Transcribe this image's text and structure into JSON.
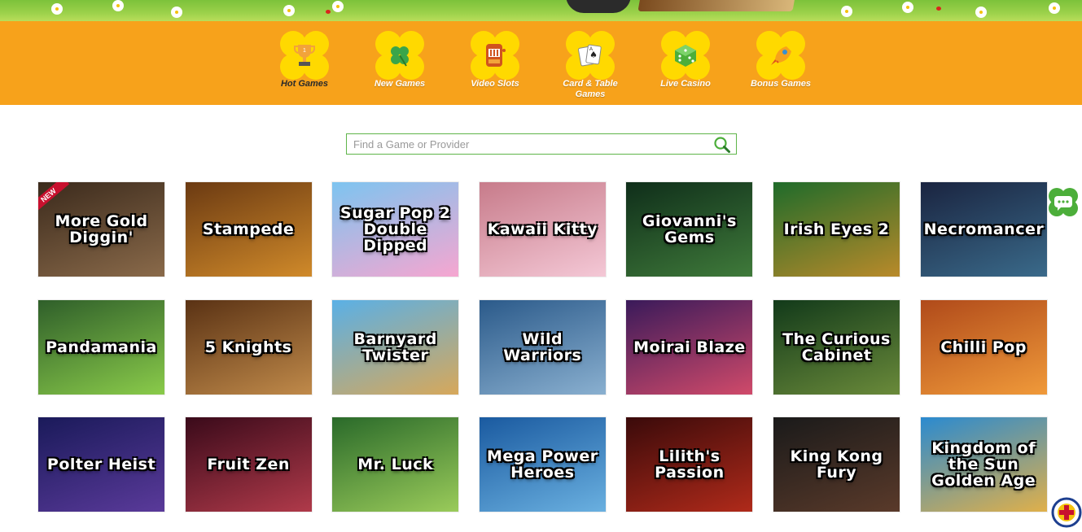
{
  "nav": {
    "items": [
      {
        "label": "Hot Games",
        "icon": "trophy-icon",
        "active": true
      },
      {
        "label": "New Games",
        "icon": "clover-icon",
        "active": false
      },
      {
        "label": "Video Slots",
        "icon": "slot-machine-icon",
        "active": false
      },
      {
        "label": "Card & Table Games",
        "icon": "playing-cards-icon",
        "active": false
      },
      {
        "label": "Live Casino",
        "icon": "dice-icon",
        "active": false
      },
      {
        "label": "Bonus Games",
        "icon": "rocket-icon",
        "active": false
      }
    ]
  },
  "search": {
    "placeholder": "Find a Game or Provider",
    "value": "",
    "icon": "search-icon"
  },
  "games": [
    {
      "title": "More Gold Diggin'",
      "badge": "NEW",
      "bg": [
        "#3b2a1c",
        "#8a6a4a"
      ]
    },
    {
      "title": "Stampede",
      "bg": [
        "#6b3a12",
        "#d08a2a"
      ]
    },
    {
      "title": "Sugar Pop 2 Double Dipped",
      "bg": [
        "#7dc4f0",
        "#f6a6d0"
      ]
    },
    {
      "title": "Kawaii Kitty",
      "bg": [
        "#c77b8a",
        "#f4c8d6"
      ]
    },
    {
      "title": "Giovanni's Gems",
      "bg": [
        "#0f2e1a",
        "#3f7a3a"
      ]
    },
    {
      "title": "Irish Eyes 2",
      "bg": [
        "#1f6b2a",
        "#b98a2a"
      ]
    },
    {
      "title": "Necromancer",
      "bg": [
        "#1a2440",
        "#3a6a8a"
      ]
    },
    {
      "title": "Pandamania",
      "bg": [
        "#2f5f2a",
        "#8acb4a"
      ]
    },
    {
      "title": "5 Knights",
      "bg": [
        "#5a3214",
        "#c08a4a"
      ]
    },
    {
      "title": "Barnyard Twister",
      "bg": [
        "#5ab0e6",
        "#d7a85a"
      ]
    },
    {
      "title": "Wild Warriors",
      "bg": [
        "#2b5a8a",
        "#8ab0d0"
      ]
    },
    {
      "title": "Moirai Blaze",
      "bg": [
        "#3a1a5a",
        "#d04a6a"
      ]
    },
    {
      "title": "The Curious Cabinet",
      "bg": [
        "#123a1a",
        "#6a8a3a"
      ]
    },
    {
      "title": "Chilli Pop",
      "bg": [
        "#b04a1a",
        "#f09a3a"
      ]
    },
    {
      "title": "Polter Heist",
      "bg": [
        "#1a1a5a",
        "#5a3a9a"
      ]
    },
    {
      "title": "Fruit Zen",
      "bg": [
        "#3a0a1a",
        "#b03a4a"
      ]
    },
    {
      "title": "Mr. Luck",
      "bg": [
        "#2a6a2a",
        "#9acb5a"
      ]
    },
    {
      "title": "Mega Power Heroes",
      "bg": [
        "#1a5aa0",
        "#6ab0e0"
      ]
    },
    {
      "title": "Lilith's Passion",
      "bg": [
        "#3a0a0a",
        "#b02a1a"
      ]
    },
    {
      "title": "King Kong Fury",
      "bg": [
        "#1a1a1a",
        "#5a3a2a"
      ]
    },
    {
      "title": "Kingdom of the Sun Golden Age",
      "bg": [
        "#2a8ad0",
        "#e0b04a"
      ]
    }
  ],
  "colors": {
    "nav_bg": "#f7a21b",
    "clover": "#ffd900",
    "search_border": "#5fb54a",
    "chat": "#4cae3a"
  },
  "widgets": {
    "chat_icon": "chat-bubble-icon",
    "seal_icon": "seal-logo-icon"
  }
}
